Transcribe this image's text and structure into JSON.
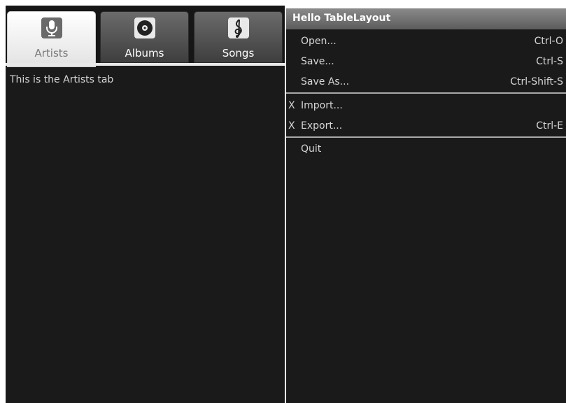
{
  "tabs_screen": {
    "tabs": [
      {
        "label": "Artists",
        "icon": "microphone-icon",
        "selected": true
      },
      {
        "label": "Albums",
        "icon": "disc-icon",
        "selected": false
      },
      {
        "label": "Songs",
        "icon": "treble-clef-icon",
        "selected": false
      }
    ],
    "content_text": "This is the Artists tab"
  },
  "table_screen": {
    "title": "Hello TableLayout",
    "rows": [
      {
        "marker": "",
        "label": "Open...",
        "shortcut": "Ctrl-O"
      },
      {
        "marker": "",
        "label": "Save...",
        "shortcut": "Ctrl-S"
      },
      {
        "marker": "",
        "label": "Save As...",
        "shortcut": "Ctrl-Shift-S"
      },
      {
        "marker": "X",
        "label": "Import...",
        "shortcut": ""
      },
      {
        "marker": "X",
        "label": "Export...",
        "shortcut": "Ctrl-E"
      },
      {
        "marker": "",
        "label": "Quit",
        "shortcut": ""
      }
    ]
  },
  "colors": {
    "background": "#1a1a1a",
    "text": "#d6d6d6",
    "title_bar": "#6f6f6f",
    "divider": "#a9a9a9"
  }
}
